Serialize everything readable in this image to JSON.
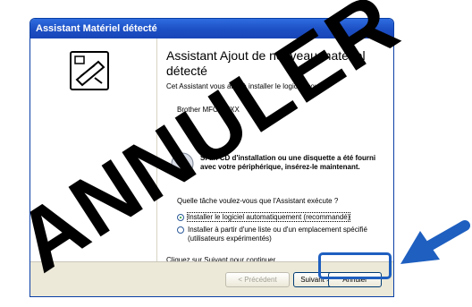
{
  "window": {
    "title": "Assistant Matériel détecté"
  },
  "heading": "Assistant Ajout de nouveau matériel détecté",
  "intro": "Cet Assistant vous aide à installer le logiciel pour :",
  "device_name": "Brother MFC-XXXX",
  "cd_instruction": "Si un CD d'installation ou une disquette a été fourni avec votre périphérique, insérez-le maintenant.",
  "question": "Quelle tâche voulez-vous que l'Assistant exécute ?",
  "options": [
    {
      "label": "Installer le logiciel automatiquement (recommandé)",
      "selected": true
    },
    {
      "label": "Installer à partir d'une liste ou d'un emplacement spécifié (utilisateurs expérimentés)",
      "selected": false
    }
  ],
  "footer_text": "Cliquez sur Suivant pour continuer.",
  "buttons": {
    "back": "< Précédent",
    "next": "Suivant >",
    "cancel": "Annuler"
  },
  "watermark": "ANNULER",
  "colors": {
    "watermark": "#000000",
    "arrow": "#1e5fc0",
    "titlebar": "#1c4fc4"
  }
}
